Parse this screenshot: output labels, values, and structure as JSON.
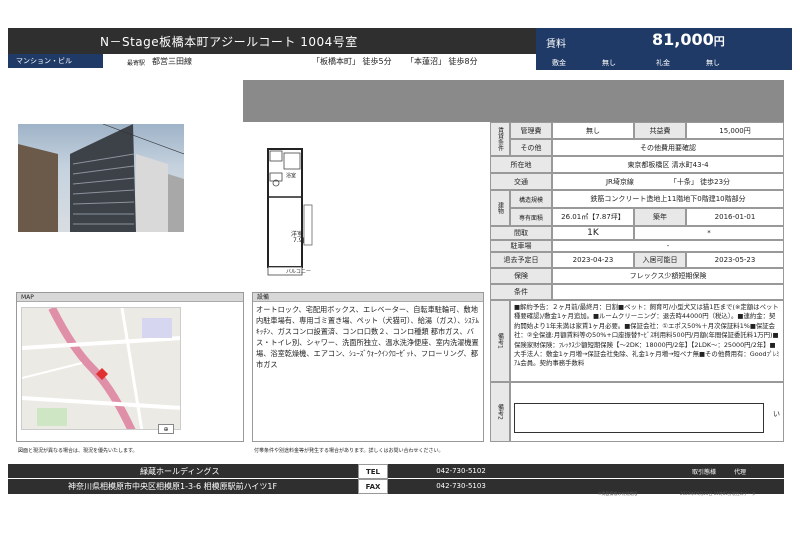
{
  "header": {
    "title": "N－Stage板橋本町アジールコート 1004号室",
    "type_badge": "マンション・ビル",
    "line_label": "最寄駅",
    "line": "都営三田線",
    "station1": "「板橋本町」 徒歩5分",
    "station2": "「本蓮沼」 徒歩8分",
    "rent_label": "賃料",
    "rent_value": "81,000",
    "rent_unit": "円",
    "deposit_label": "敷金",
    "deposit_value": "無し",
    "key_label": "礼金",
    "key_value": "無し"
  },
  "floorplan": {
    "room_label": "洋室",
    "room_size": "7.9J",
    "balcony": "バルコニー",
    "bath": "浴室"
  },
  "map": {
    "title": "MAP"
  },
  "equipment": {
    "title": "設備",
    "text": "オートロック、宅配用ボックス、エレベーター、自転車駐輪可、敷地内駐車場有、専用ゴミ置き場、ペット（犬猫可）、給湯（ガス）、ｼｽﾃﾑｷｯﾁﾝ、ガスコンロ設置済、コンロ口数２、コンロ種類 都市ガス、バス・トイレ別、シャワー、洗面所独立、温水洗浄便座、室内洗濯機置場、浴室乾燥機、エアコン、ｼｭｰｽﾞｳｫｰｸｲﾝｸﾛｰｾﾞｯﾄ、フローリング、都市ガス"
  },
  "details": {
    "conditions_label": "賃貸条件",
    "mgmt_fee_label": "管理費",
    "mgmt_fee_value": "無し",
    "common_fee_label": "共益費",
    "common_fee_value": "15,000円",
    "other_label": "その他",
    "other_value": "その他費用要確認",
    "address_label": "所在地",
    "address_value": "東京都板橋区 清水町43-4",
    "transport_label": "交通",
    "transport_line": "JR埼京線",
    "transport_station": "「十条」 徒歩23分",
    "building_label": "建物",
    "structure_label": "構造規模",
    "structure_value": "鉄筋コンクリート造地上11階地下0階建10階部分",
    "area_label": "専有面積",
    "area_value": "26.01㎡【7.87坪】",
    "built_label": "築年",
    "built_value": "2016-01-01",
    "layout_label": "間取",
    "layout_value": "1K",
    "layout_extra": "*",
    "parking_label": "駐車場",
    "parking_value": "-",
    "vacate_label": "退去予定日",
    "vacate_value": "2023-04-23",
    "movein_label": "入居可能日",
    "movein_value": "2023-05-23",
    "insurance_label": "保険",
    "insurance_value": "フレックス少額短期保険",
    "terms_label": "条件",
    "terms_value": "",
    "remarks1_label": "備考1",
    "remarks1_text": "■解約予告：２ヶ月前/最終月：日割■ペット：飼育可/小型犬又は猫1匹まで(※定額はペット種要確認)/敷金1ヶ月追加。■ルームクリーニング：退去時44000円（税込）。■連約金：契約開始より1年未満は家賃1ヶ月必要。■保証会社：①エポス50%＋月次保証料1%■保証会社：②全保連:月額賃料等の50%+口座振替ｻｰﾋﾞｽ利用料500円/月額(年間保証委託料1万円)■保険家財保険：ﾌﾚｯｸｽ少額短期保険【～2DK：18000円/2年】【2LDK～：25000円/2年】■大手法人：敷金1ヶ月増→保証会社免除、礼金1ヶ月増→短ペナ無■その他費用有：Goodﾌﾟﾚﾐｱﾑ会員。契約事務手数料",
    "remarks2_label": "備考2",
    "remarks2_text": "い"
  },
  "notes": {
    "left": "図面と現況が異なる場合は、現況を優先いたします。",
    "right": "付帯条件や別途料金等が発生する場合があります。詳しくはお問い合わせください。"
  },
  "footer": {
    "company": "緑蔵ホールディングス",
    "address": "神奈川県相模原市中央区相模原1-3-6 相模原駅前ハイツ1F",
    "tel_label": "TEL",
    "tel": "042-730-5102",
    "fax_label": "FAX",
    "fax": "042-730-5103",
    "deal_label": "取引態様",
    "deal_value": "代理",
    "fine1": "※掲載情報の有効期限",
    "fine2": "2023年04月23日 14時05分現在のデータ"
  }
}
